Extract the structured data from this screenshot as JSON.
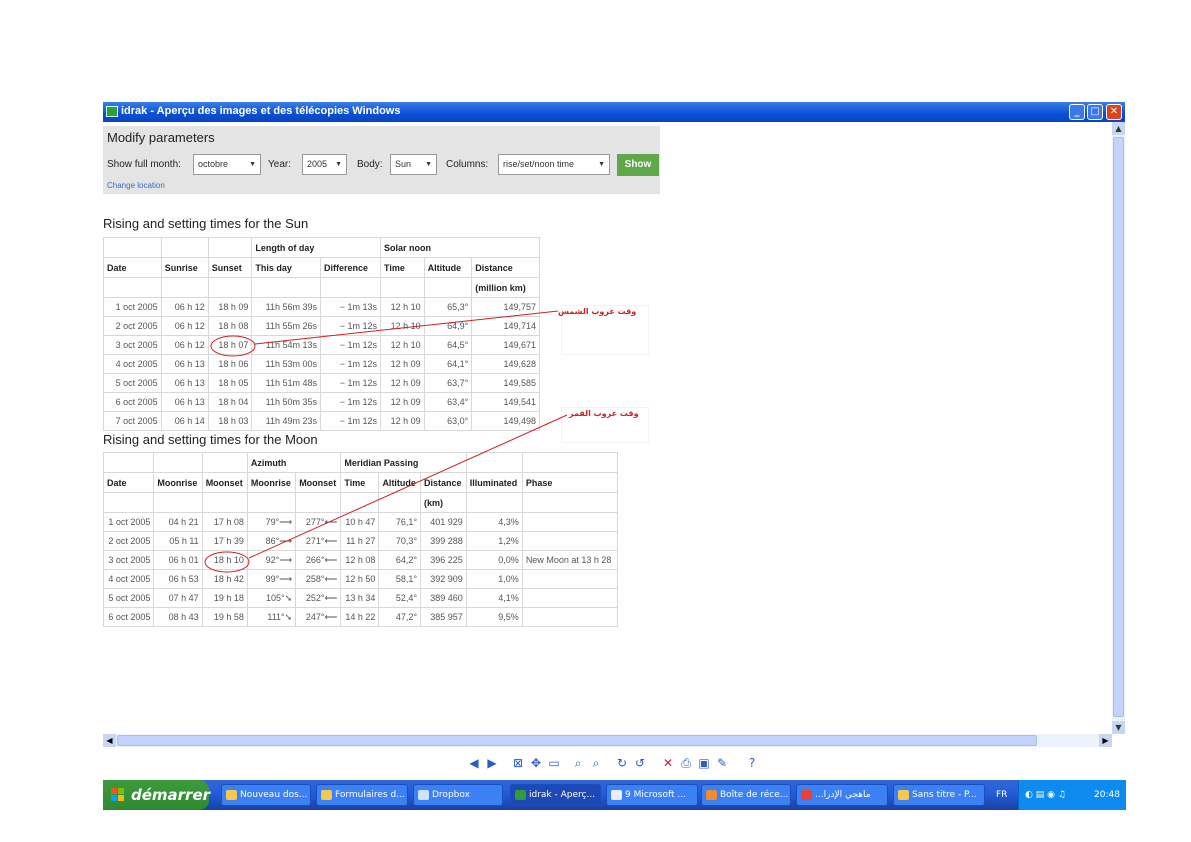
{
  "window": {
    "title": "idrak - Aperçu des images et des télécopies Windows"
  },
  "form": {
    "heading": "Modify parameters",
    "month_label": "Show full month:",
    "month_value": "octobre",
    "year_label": "Year:",
    "year_value": "2005",
    "body_label": "Body:",
    "body_value": "Sun",
    "columns_label": "Columns:",
    "columns_value": "rise/set/noon time",
    "show_label": "Show",
    "change_location": "Change location"
  },
  "sun": {
    "title": "Rising and setting times for the Sun",
    "group_headers": {
      "length": "Length of day",
      "noon": "Solar noon"
    },
    "columns": [
      "Date",
      "Sunrise",
      "Sunset",
      "This day",
      "Difference",
      "Time",
      "Altitude",
      "Distance"
    ],
    "distance_unit": "(million km)",
    "rows": [
      [
        "1 oct 2005",
        "06 h 12",
        "18 h 09",
        "11h 56m 39s",
        "− 1m 13s",
        "12 h 10",
        "65,3°",
        "149,757"
      ],
      [
        "2 oct 2005",
        "06 h 12",
        "18 h 08",
        "11h 55m 26s",
        "− 1m 12s",
        "12 h 10",
        "64,9°",
        "149,714"
      ],
      [
        "3 oct 2005",
        "06 h 12",
        "18 h 07",
        "11h 54m 13s",
        "− 1m 12s",
        "12 h 10",
        "64,5°",
        "149,671"
      ],
      [
        "4 oct 2005",
        "06 h 13",
        "18 h 06",
        "11h 53m 00s",
        "− 1m 12s",
        "12 h 09",
        "64,1°",
        "149,628"
      ],
      [
        "5 oct 2005",
        "06 h 13",
        "18 h 05",
        "11h 51m 48s",
        "− 1m 12s",
        "12 h 09",
        "63,7°",
        "149,585"
      ],
      [
        "6 oct 2005",
        "06 h 13",
        "18 h 04",
        "11h 50m 35s",
        "− 1m 12s",
        "12 h 09",
        "63,4°",
        "149,541"
      ],
      [
        "7 oct 2005",
        "06 h 14",
        "18 h 03",
        "11h 49m 23s",
        "− 1m 12s",
        "12 h 09",
        "63,0°",
        "149,498"
      ]
    ]
  },
  "moon": {
    "title": "Rising and setting times for the Moon",
    "group_headers": {
      "azimuth": "Azimuth",
      "meridian": "Meridian Passing"
    },
    "columns": [
      "Date",
      "Moonrise",
      "Moonset",
      "Moonrise",
      "Moonset",
      "Time",
      "Altitude",
      "Distance",
      "Illuminated",
      "Phase"
    ],
    "distance_unit": "(km)",
    "rows": [
      [
        "1 oct 2005",
        "04 h 21",
        "17 h 08",
        "79°⟶",
        "277°⟵",
        "10 h 47",
        "76,1°",
        "401 929",
        "4,3%",
        ""
      ],
      [
        "2 oct 2005",
        "05 h 11",
        "17 h 39",
        "86°⟶",
        "271°⟵",
        "11 h 27",
        "70,3°",
        "399 288",
        "1,2%",
        ""
      ],
      [
        "3 oct 2005",
        "06 h 01",
        "18 h 10",
        "92°⟶",
        "266°⟵",
        "12 h 08",
        "64,2°",
        "396 225",
        "0,0%",
        "New Moon at 13 h 28"
      ],
      [
        "4 oct 2005",
        "06 h 53",
        "18 h 42",
        "99°⟶",
        "258°⟵",
        "12 h 50",
        "58,1°",
        "392 909",
        "1,0%",
        ""
      ],
      [
        "5 oct 2005",
        "07 h 47",
        "19 h 18",
        "105°➘",
        "252°⟵",
        "13 h 34",
        "52,4°",
        "389 460",
        "4,1%",
        ""
      ],
      [
        "6 oct 2005",
        "08 h 43",
        "19 h 58",
        "111°➘",
        "247°⟵",
        "14 h 22",
        "47,2°",
        "385 957",
        "9,5%",
        ""
      ]
    ]
  },
  "annotations": {
    "sun_note": "وقت غروب الشمس",
    "moon_note": "وقت غروب القمر",
    "color": "#d02020"
  },
  "taskbar": {
    "start": "démarrer",
    "items": [
      "Nouveau dos...",
      "Formulaires d...",
      "Dropbox",
      "idrak - Aperç...",
      "9 Microsoft ...",
      "Boîte de réce...",
      "...ماهجي الإدرا",
      "Sans titre - P..."
    ],
    "lang": "FR",
    "clock": "20:48"
  }
}
